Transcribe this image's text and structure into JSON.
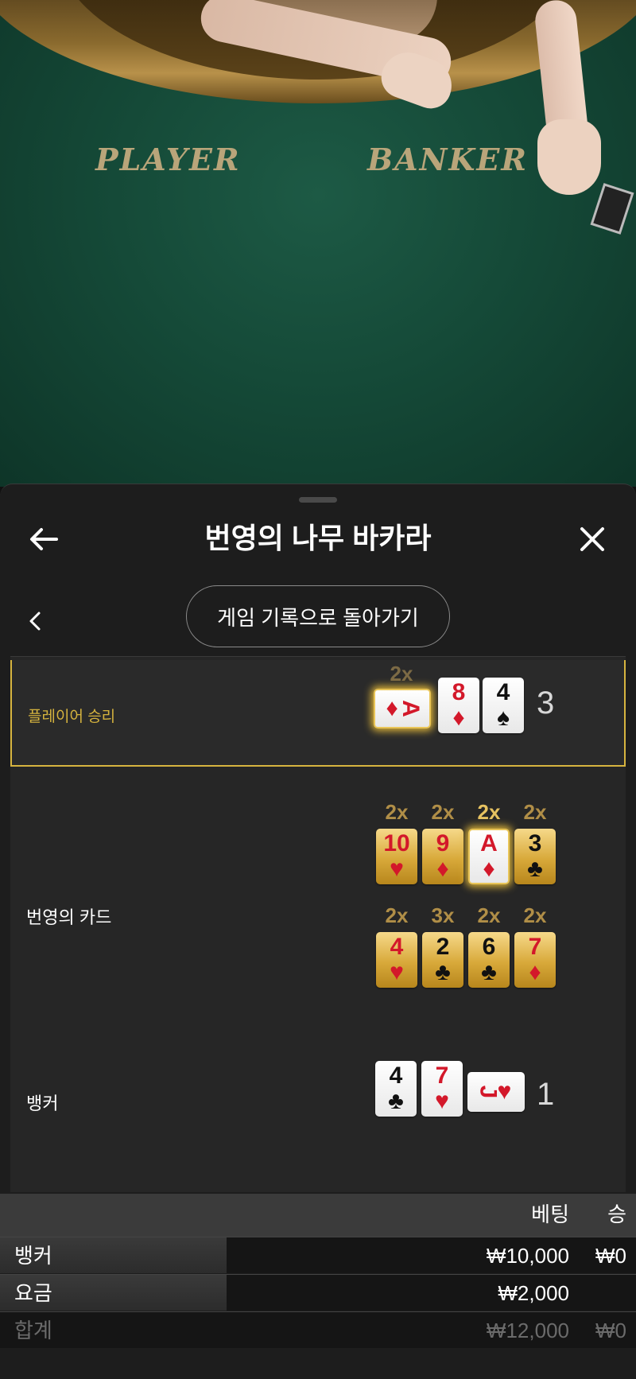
{
  "video": {
    "felt_player": "PLAYER",
    "felt_banker": "BANKER"
  },
  "header": {
    "title": "번영의 나무 바카라",
    "back_icon": "arrow-left-icon",
    "close_icon": "close-icon"
  },
  "nav": {
    "prev_icon": "chevron-left-icon",
    "history_button": "게임 기록으로 돌아가기"
  },
  "result": {
    "player_label": "플레이어 승리",
    "player_score": "3",
    "player_multiplier": "2x",
    "player_cards": [
      {
        "rank": "A",
        "suit": "♦",
        "color": "red",
        "orientation": "sideways",
        "highlight": true
      },
      {
        "rank": "8",
        "suit": "♦",
        "color": "red"
      },
      {
        "rank": "4",
        "suit": "♠",
        "color": "black"
      }
    ],
    "golden_label": "번영의 카드",
    "golden_rows": [
      [
        {
          "mult": "2x",
          "rank": "10",
          "suit": "♥",
          "color": "red"
        },
        {
          "mult": "2x",
          "rank": "9",
          "suit": "♦",
          "color": "red"
        },
        {
          "mult": "2x",
          "rank": "A",
          "suit": "♦",
          "color": "red",
          "highlight": true
        },
        {
          "mult": "2x",
          "rank": "3",
          "suit": "♣",
          "color": "black"
        }
      ],
      [
        {
          "mult": "2x",
          "rank": "4",
          "suit": "♥",
          "color": "red"
        },
        {
          "mult": "3x",
          "rank": "2",
          "suit": "♣",
          "color": "black"
        },
        {
          "mult": "2x",
          "rank": "6",
          "suit": "♣",
          "color": "black"
        },
        {
          "mult": "2x",
          "rank": "7",
          "suit": "♦",
          "color": "red"
        }
      ]
    ],
    "banker_label": "뱅커",
    "banker_score": "1",
    "banker_cards": [
      {
        "rank": "4",
        "suit": "♣",
        "color": "black"
      },
      {
        "rank": "7",
        "suit": "♥",
        "color": "red"
      },
      {
        "rank": "J",
        "suit": "♥",
        "color": "red",
        "orientation": "sideways"
      }
    ]
  },
  "bet_table": {
    "col_bet": "베팅",
    "col_win": "승",
    "rows": [
      {
        "label": "뱅커",
        "bet": "₩10,000",
        "win": "₩0"
      },
      {
        "label": "요금",
        "bet": "₩2,000",
        "win": ""
      },
      {
        "label": "합계",
        "bet": "₩12,000",
        "win": "₩0"
      }
    ]
  },
  "colors": {
    "felt": "#154a38",
    "panel": "#1d1d1d",
    "accent_gold": "#d5b33e",
    "card_red": "#d3182a"
  }
}
